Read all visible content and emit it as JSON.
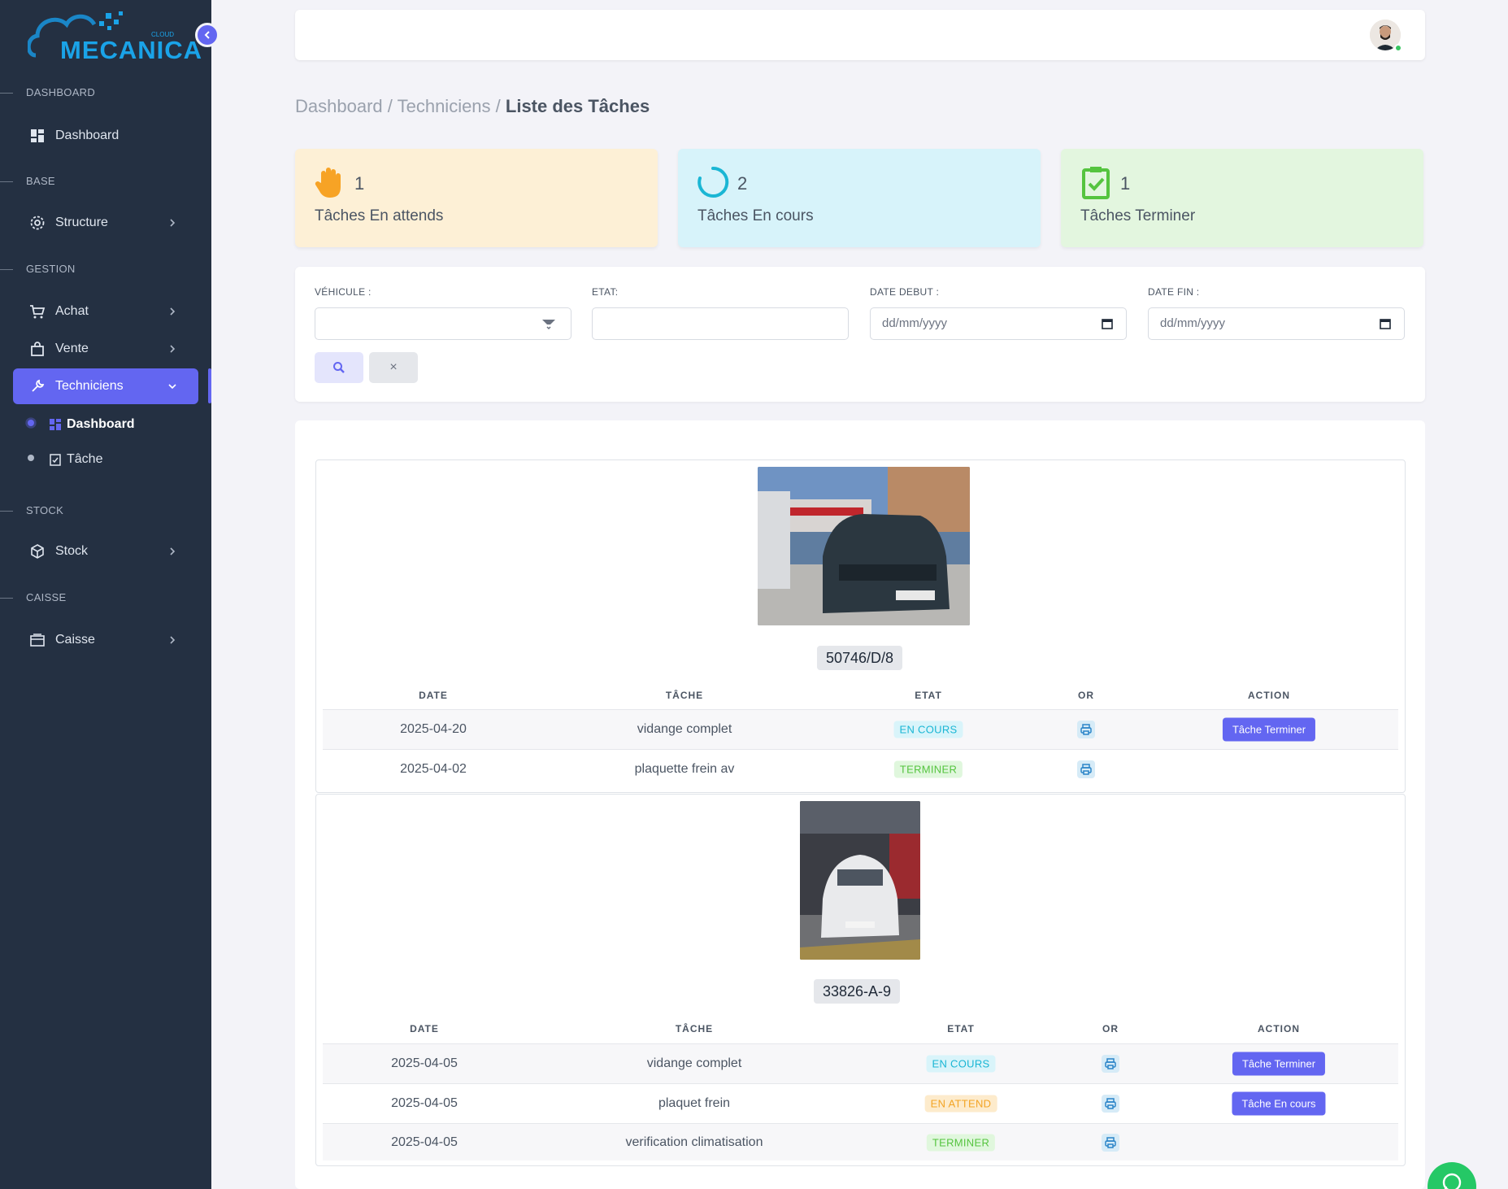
{
  "sidebar": {
    "logo": {
      "text": "MECANICA",
      "small": "CLOUD"
    },
    "sections": {
      "dashboard": "DASHBOARD",
      "base": "BASE",
      "gestion": "GESTION",
      "stock": "STOCK",
      "caisse": "CAISSE"
    },
    "items": {
      "dashboard": "Dashboard",
      "structure": "Structure",
      "achat": "Achat",
      "vente": "Vente",
      "techniciens": "Techniciens",
      "sub_dashboard": "Dashboard",
      "sub_tache": "Tâche",
      "stock": "Stock",
      "caisse": "Caisse"
    }
  },
  "breadcrumb": {
    "part1": "Dashboard",
    "sep": " / ",
    "part2": "Techniciens",
    "current": "Liste des Tâches"
  },
  "stats": [
    {
      "count": "1",
      "label": "Tâches En attends",
      "bg": "#fdf0d6",
      "icon": "hand-icon"
    },
    {
      "count": "2",
      "label": "Tâches En cours",
      "bg": "#d7f3fa",
      "icon": "spinner-icon"
    },
    {
      "count": "1",
      "label": "Tâches Terminer",
      "bg": "#e3f6df",
      "icon": "clipboard-check-icon"
    }
  ],
  "filters": {
    "vehicule_label": "VÉHICULE :",
    "etat_label": "ETAT:",
    "date_debut_label": "DATE DEBUT :",
    "date_fin_label": "DATE FIN :",
    "date_placeholder": "dd/mm/yyyy",
    "clear": "×"
  },
  "table_headers": {
    "date": "DATE",
    "tache": "TÂCHE",
    "etat": "ETAT",
    "or": "OR",
    "action": "ACTION"
  },
  "vehicles": [
    {
      "plate": "50746/D/8",
      "rows": [
        {
          "date": "2025-04-20",
          "task": "vidange complet",
          "status": "EN COURS",
          "action": "Tâche Terminer"
        },
        {
          "date": "2025-04-02",
          "task": "plaquette frein av",
          "status": "TERMINER",
          "action": ""
        }
      ]
    },
    {
      "plate": "33826-A-9",
      "rows": [
        {
          "date": "2025-04-05",
          "task": "vidange complet",
          "status": "EN COURS",
          "action": "Tâche Terminer"
        },
        {
          "date": "2025-04-05",
          "task": "plaquet frein",
          "status": "EN ATTEND",
          "action": "Tâche En cours"
        },
        {
          "date": "2025-04-05",
          "task": "verification climatisation",
          "status": "TERMINER",
          "action": ""
        }
      ]
    }
  ],
  "colors": {
    "accent": "#6366f1",
    "sidebar": "#243042",
    "whatsapp": "#25c866"
  }
}
